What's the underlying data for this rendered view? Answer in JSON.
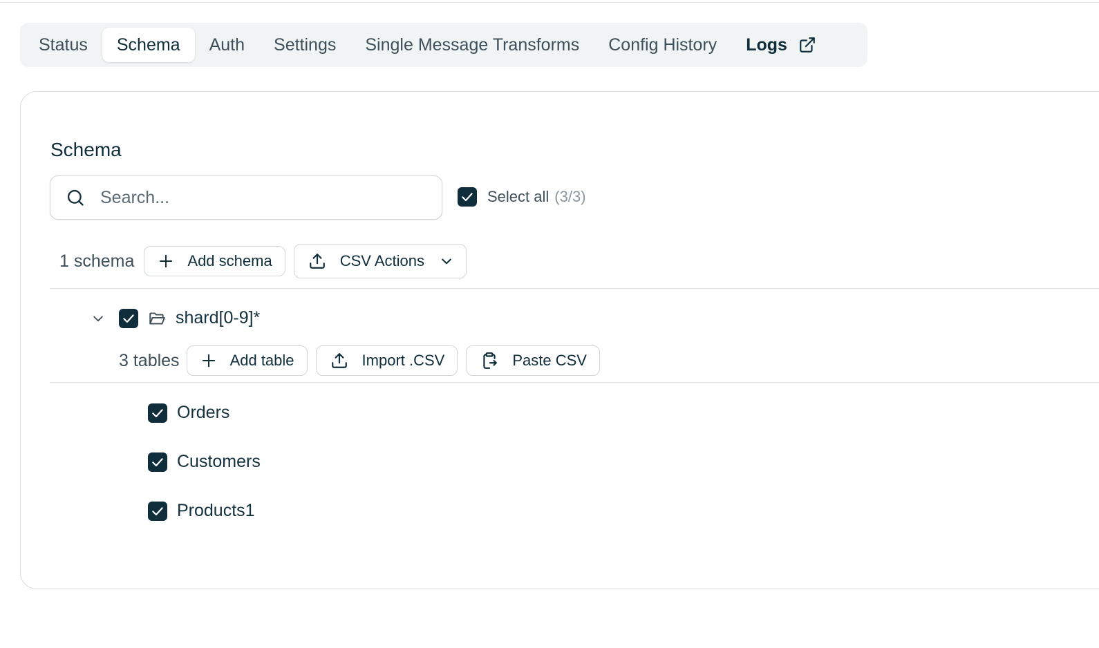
{
  "tabs": [
    {
      "label": "Status"
    },
    {
      "label": "Schema"
    },
    {
      "label": "Auth"
    },
    {
      "label": "Settings"
    },
    {
      "label": "Single Message Transforms"
    },
    {
      "label": "Config History"
    },
    {
      "label": "Logs"
    }
  ],
  "active_tab": "Schema",
  "section": {
    "title": "Schema",
    "search_placeholder": "Search...",
    "select_all_label": "Select all",
    "select_all_count": "(3/3)",
    "schema_count": "1 schema",
    "add_schema_label": "Add schema",
    "csv_actions_label": "CSV Actions"
  },
  "schema": {
    "name": "shard[0-9]*",
    "checked": true,
    "expanded": true,
    "tables_count": "3 tables",
    "add_table_label": "Add table",
    "import_csv_label": "Import .CSV",
    "paste_csv_label": "Paste CSV",
    "tables": [
      {
        "name": "Orders",
        "checked": true
      },
      {
        "name": "Customers",
        "checked": true
      },
      {
        "name": "Products1",
        "checked": true
      }
    ]
  },
  "icons": {
    "search": "search-icon",
    "external": "external-link-icon",
    "plus": "plus-icon",
    "upload": "upload-icon",
    "chevron_down": "chevron-down-icon",
    "folder": "folder-open-icon",
    "paste": "clipboard-paste-icon",
    "check": "check-icon"
  },
  "colors": {
    "accent": "#0f2d3a",
    "tab_bar_bg": "#f1f4f5",
    "border": "#cfd5d9"
  }
}
